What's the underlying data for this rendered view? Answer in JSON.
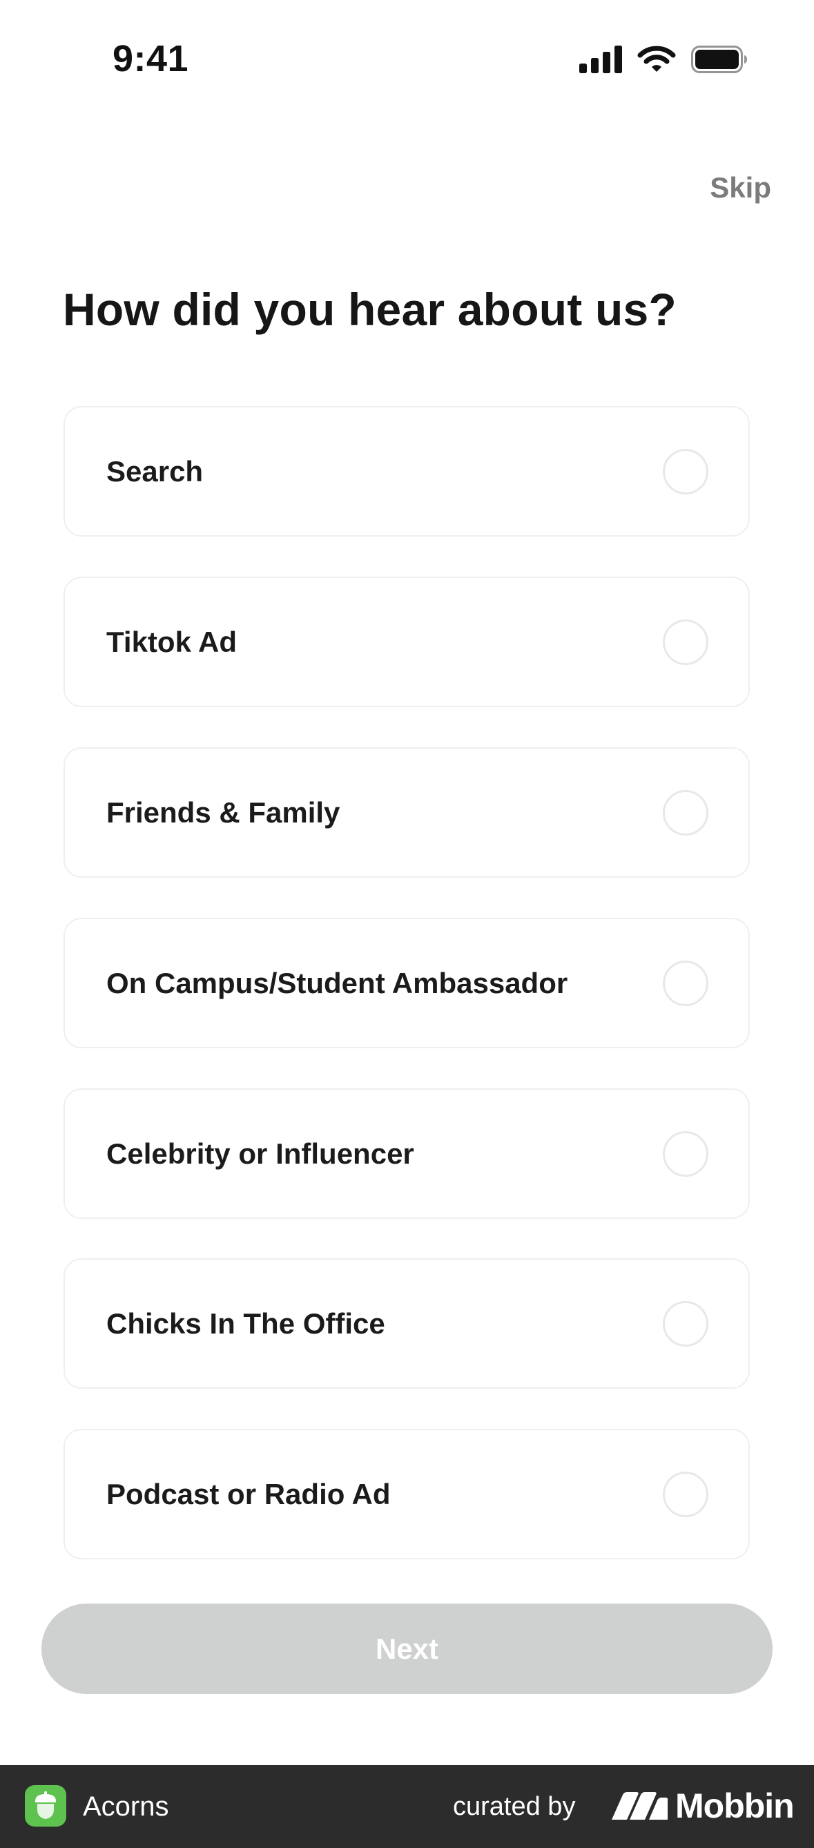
{
  "status_bar": {
    "time": "9:41",
    "icons": [
      "cellular-signal-icon",
      "wifi-icon",
      "battery-icon"
    ]
  },
  "header": {
    "skip_label": "Skip"
  },
  "question": {
    "title": "How did you hear about us?"
  },
  "options": [
    {
      "label": "Search",
      "selected": false
    },
    {
      "label": "Tiktok Ad",
      "selected": false
    },
    {
      "label": "Friends & Family",
      "selected": false
    },
    {
      "label": "On Campus/Student Ambassador",
      "selected": false
    },
    {
      "label": "Celebrity or Influencer",
      "selected": false
    },
    {
      "label": "Chicks In The Office",
      "selected": false
    },
    {
      "label": "Podcast or Radio Ad",
      "selected": false
    }
  ],
  "actions": {
    "next_label": "Next",
    "next_enabled": false
  },
  "footer": {
    "app_name": "Acorns",
    "curated_by": "curated by",
    "brand_name": "Mobbin",
    "app_icon": "acorn-icon",
    "brand_icon": "mobbin-logo-icon"
  },
  "colors": {
    "disabled_button": "#cfd0d0",
    "skip_text": "#7b7b7b",
    "card_border": "#efefef",
    "footer_bg": "#2c2c2c",
    "app_icon_bg": "#5ec24e"
  }
}
